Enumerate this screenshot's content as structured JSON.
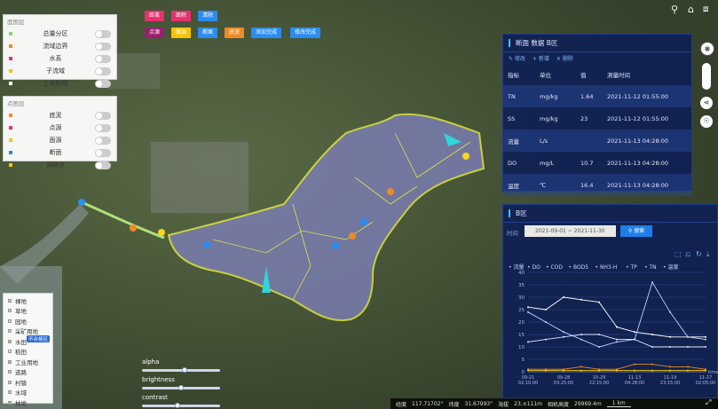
{
  "map_colors": {
    "basin_fill": "#7d7fb8",
    "basin_border": "#e8ee42",
    "river": "#2fd6d6",
    "orange": "#f08a24",
    "yellow": "#f7d51d",
    "blue": "#2c8cf0"
  },
  "toolbar": {
    "row1": [
      {
        "label": "距离",
        "color": "#e8306f"
      },
      {
        "label": "面积",
        "color": "#e8306f"
      },
      {
        "label": "清除",
        "color": "#2b8cf0"
      }
    ],
    "row2": [
      {
        "label": "点源",
        "color": "#9a1f6e"
      },
      {
        "label": "面源",
        "color": "#f7c500"
      },
      {
        "label": "断面",
        "color": "#2b8cf0"
      },
      {
        "label": "底泥",
        "color": "#f08a24"
      },
      {
        "label": "添加完成",
        "color": "#2b8cf0"
      },
      {
        "label": "修改完成",
        "color": "#2b8cf0"
      }
    ]
  },
  "layers_panel": {
    "title": "面图层",
    "items": [
      {
        "label": "总量分区",
        "color": "#8fd46b"
      },
      {
        "label": "流域边界",
        "color": "#f08a24"
      },
      {
        "label": "水系",
        "color": "#e8306f"
      },
      {
        "label": "子流域",
        "color": "#f7c500"
      },
      {
        "label": "土地利用",
        "color": "#ffffff"
      }
    ]
  },
  "points_panel": {
    "title": "点图层",
    "items": [
      {
        "label": "底泥",
        "color": "#f08a24"
      },
      {
        "label": "点源",
        "color": "#e8306f"
      },
      {
        "label": "面源",
        "color": "#f7c500"
      },
      {
        "label": "断面",
        "color": "#2b8cf0"
      },
      {
        "label": "调研点",
        "color": "#f7c500"
      }
    ]
  },
  "section_panel": {
    "title": "断面 数据 B区",
    "actions": [
      "修改",
      "新增",
      "删除"
    ],
    "headers": [
      "指标",
      "单位",
      "值",
      "测量时间"
    ],
    "rows": [
      [
        "TN",
        "mg/kg",
        "1.64",
        "2021-11-12 01:55:00"
      ],
      [
        "SS",
        "mg/kg",
        "23",
        "2021-11-12 01:55:00"
      ],
      [
        "流量",
        "L/s",
        "",
        "2021-11-13 04:28:00"
      ],
      [
        "DO",
        "mg/L",
        "10.7",
        "2021-11-13 04:28:00"
      ],
      [
        "温度",
        "℃",
        "16.4",
        "2021-11-13 04:28:00"
      ]
    ]
  },
  "chart_panel": {
    "title": "B区",
    "time_label": "时间",
    "date_from": "2021-09-01",
    "date_sep": "~",
    "date_to": "2021-11-30",
    "search_label": "搜索"
  },
  "chart_data": {
    "type": "line",
    "legend": [
      "流量",
      "DO",
      "COD",
      "BOD5",
      "NH3-H",
      "TP",
      "TN",
      "温度"
    ],
    "xlabel": "time",
    "x_ticks": [
      [
        "09-21",
        "02:10:00"
      ],
      [
        "09-28",
        "03:25:00"
      ],
      [
        "10-29",
        "22:15:00"
      ],
      [
        "11-13",
        "04:28:00"
      ],
      [
        "11-19",
        "23:15:00"
      ],
      [
        "11-27",
        "02:05:00"
      ]
    ],
    "ylim": [
      0,
      40
    ],
    "y_ticks": [
      0,
      5,
      10,
      15,
      20,
      25,
      30,
      35,
      40
    ],
    "series": [
      {
        "name": "流量",
        "color": "#ffffff",
        "values": [
          26,
          25,
          30,
          29,
          28,
          18,
          16,
          15,
          14,
          14,
          14
        ]
      },
      {
        "name": "DO",
        "color": "#bcd4ff",
        "values": [
          24,
          20,
          16,
          13,
          10,
          12,
          13,
          36,
          24,
          14,
          13
        ]
      },
      {
        "name": "温度",
        "color": "#e0e6ff",
        "values": [
          12,
          13,
          14,
          15,
          15,
          13,
          13,
          10,
          10,
          10,
          10
        ]
      },
      {
        "name": "COD",
        "color": "#f08a24",
        "values": [
          1,
          1,
          1,
          2,
          1,
          1,
          3,
          3,
          2,
          2,
          1
        ]
      },
      {
        "name": "TN",
        "color": "#f7c500",
        "values": [
          0.5,
          0.5,
          0.5,
          0.5,
          0.5,
          0.5,
          0.5,
          0.5,
          0.5,
          0.5,
          0.5
        ]
      }
    ]
  },
  "legend_panel": {
    "items": [
      {
        "label": "裸地",
        "color": "#d8b9e6"
      },
      {
        "label": "草地",
        "color": "#b9e6a8"
      },
      {
        "label": "园地",
        "color": "#c4e6a0"
      },
      {
        "label": "采矿用地",
        "color": "#e6d09a"
      },
      {
        "label": "水田",
        "color": "#f5a3a3"
      },
      {
        "label": "稻田",
        "color": "#f4f0a5"
      },
      {
        "label": "工业用地",
        "color": "#e6a3a3"
      },
      {
        "label": "道路",
        "color": "#cccccc"
      },
      {
        "label": "村镇",
        "color": "#f2b8c6"
      },
      {
        "label": "水域",
        "color": "#a5d4f4"
      },
      {
        "label": "林地",
        "color": "#7fcf7f"
      }
    ],
    "badge": "不合格区"
  },
  "sliders": [
    {
      "label": "alpha",
      "value": 0.55
    },
    {
      "label": "brightness",
      "value": 0.5
    },
    {
      "label": "contrast",
      "value": 0.45
    }
  ],
  "status_bar": {
    "lon_label": "经度",
    "lon": "117.71702°",
    "lat_label": "纬度",
    "lat": "31.67993°",
    "alt_label": "海拔",
    "alt": "23.±111m",
    "cam_label": "相机高度",
    "cam": "29969.4m",
    "scale": "1 km"
  }
}
